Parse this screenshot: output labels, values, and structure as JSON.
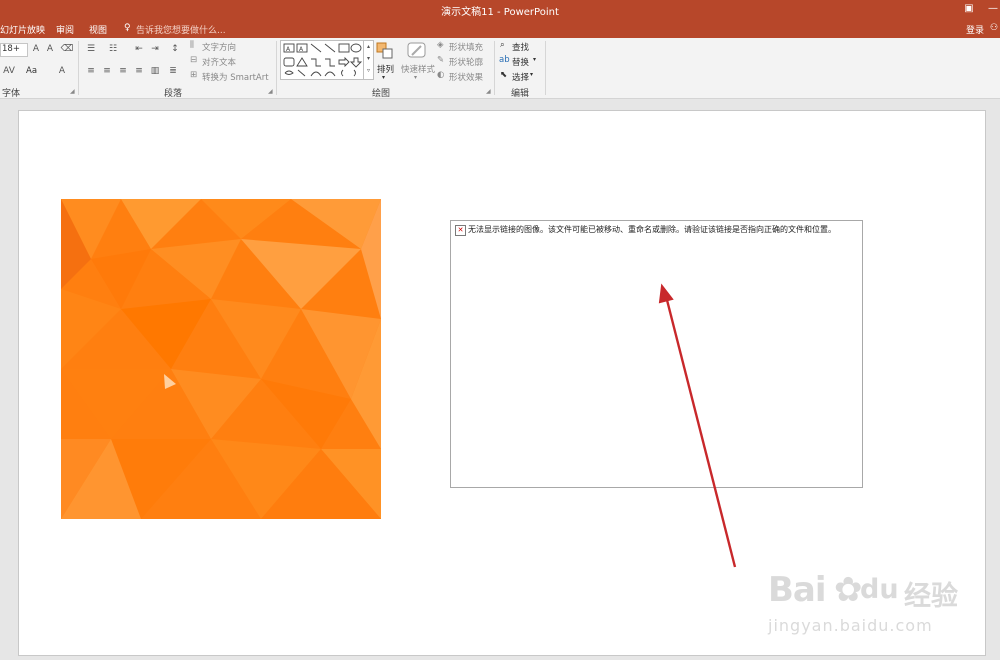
{
  "window": {
    "title": "演示文稿11 - PowerPoint"
  },
  "menu": {
    "tabs": [
      "幻灯片放映",
      "审阅",
      "视图"
    ],
    "tell_me": "告诉我您想要做什么...",
    "login": "登录"
  },
  "ribbon": {
    "groups": {
      "font": "字体",
      "paragraph": "段落",
      "drawing": "绘图",
      "editing": "编辑"
    },
    "font": {
      "size": "18+",
      "case": "Aa"
    },
    "paragraph": {
      "text_direction": "文字方向",
      "align_text": "对齐文本",
      "convert_smartart": "转换为 SmartArt"
    },
    "drawing": {
      "arrange": "排列",
      "quick_styles": "快速样式",
      "shape_fill": "形状填充",
      "shape_outline": "形状轮廓",
      "shape_effects": "形状效果"
    },
    "editing": {
      "find": "查找",
      "replace": "替换",
      "select": "选择"
    }
  },
  "slide": {
    "broken_image_message": "无法显示链接的图像。该文件可能已被移动、重命名或删除。请验证该链接是否指向正确的文件和位置。"
  },
  "watermark": {
    "brand": "Bai",
    "brand_tail": "du",
    "brand_cn": "经验",
    "url": "jingyan.baidu.com"
  },
  "colors": {
    "accent": "#b7472a",
    "arrow": "#c8282b",
    "orange": "#ff7f10"
  }
}
